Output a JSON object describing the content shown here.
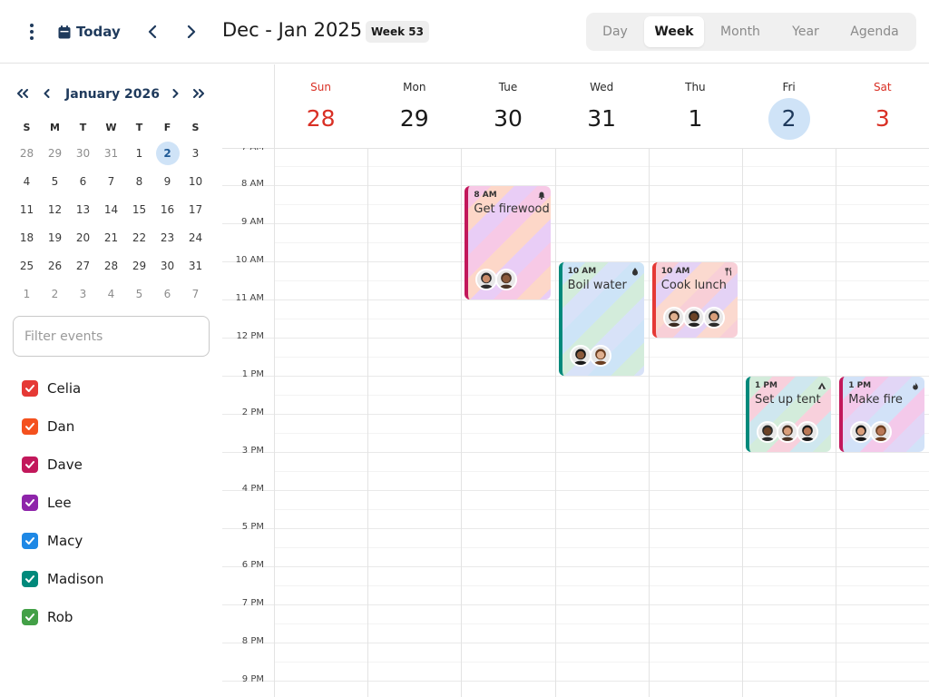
{
  "header": {
    "today_label": "Today",
    "range_title": "Dec - Jan 2025",
    "week_badge": "Week 53",
    "views": [
      "Day",
      "Week",
      "Month",
      "Year",
      "Agenda"
    ],
    "active_view": "Week"
  },
  "mini_calendar": {
    "title": "January 2026",
    "weekdays": [
      "S",
      "M",
      "T",
      "W",
      "T",
      "F",
      "S"
    ],
    "selected_day": "2",
    "weeks": [
      [
        "28",
        "29",
        "30",
        "31",
        "1",
        "2",
        "3"
      ],
      [
        "4",
        "5",
        "6",
        "7",
        "8",
        "9",
        "10"
      ],
      [
        "11",
        "12",
        "13",
        "14",
        "15",
        "16",
        "17"
      ],
      [
        "18",
        "19",
        "20",
        "21",
        "22",
        "23",
        "24"
      ],
      [
        "25",
        "26",
        "27",
        "28",
        "29",
        "30",
        "31"
      ],
      [
        "1",
        "2",
        "3",
        "4",
        "5",
        "6",
        "7"
      ]
    ]
  },
  "filter": {
    "placeholder": "Filter events",
    "value": ""
  },
  "people": [
    {
      "name": "Celia",
      "color": "#e53935",
      "checked": true
    },
    {
      "name": "Dan",
      "color": "#f4511e",
      "checked": true
    },
    {
      "name": "Dave",
      "color": "#c2185b",
      "checked": true
    },
    {
      "name": "Lee",
      "color": "#8e24aa",
      "checked": true
    },
    {
      "name": "Macy",
      "color": "#1e88e5",
      "checked": true
    },
    {
      "name": "Madison",
      "color": "#00897b",
      "checked": true
    },
    {
      "name": "Rob",
      "color": "#43a047",
      "checked": true
    }
  ],
  "week": {
    "days": [
      {
        "name": "Sun",
        "num": "28",
        "weekend": true,
        "today": false
      },
      {
        "name": "Mon",
        "num": "29",
        "weekend": false,
        "today": false
      },
      {
        "name": "Tue",
        "num": "30",
        "weekend": false,
        "today": false
      },
      {
        "name": "Wed",
        "num": "31",
        "weekend": false,
        "today": false
      },
      {
        "name": "Thu",
        "num": "1",
        "weekend": false,
        "today": false
      },
      {
        "name": "Fri",
        "num": "2",
        "weekend": false,
        "today": true
      },
      {
        "name": "Sat",
        "num": "3",
        "weekend": true,
        "today": false
      }
    ],
    "hours": [
      "8 AM",
      "9 AM",
      "10 AM",
      "11 AM",
      "12 PM",
      "1 PM",
      "2 PM",
      "3 PM",
      "4 PM",
      "5 PM",
      "6 PM",
      "7 PM",
      "8 PM",
      "9 PM"
    ]
  },
  "events": [
    {
      "title": "Get firewood",
      "time": "8 AM",
      "day": 2,
      "start": 8,
      "end": 11,
      "color": "#c2185b",
      "icon": "bell-icon",
      "attendees": 2
    },
    {
      "title": "Boil water",
      "time": "10 AM",
      "day": 3,
      "start": 10,
      "end": 13,
      "color": "#00897b",
      "icon": "water-drop-icon",
      "attendees": 2
    },
    {
      "title": "Cook lunch",
      "time": "10 AM",
      "day": 4,
      "start": 10,
      "end": 12,
      "color": "#e53935",
      "icon": "utensils-icon",
      "attendees": 3
    },
    {
      "title": "Set up tent",
      "time": "1 PM",
      "day": 5,
      "start": 13,
      "end": 15,
      "color": "#00897b",
      "icon": "tent-icon",
      "attendees": 3
    },
    {
      "title": "Make fire",
      "time": "1 PM",
      "day": 6,
      "start": 13,
      "end": 15,
      "color": "#c2185b",
      "icon": "flame-icon",
      "attendees": 2
    }
  ]
}
